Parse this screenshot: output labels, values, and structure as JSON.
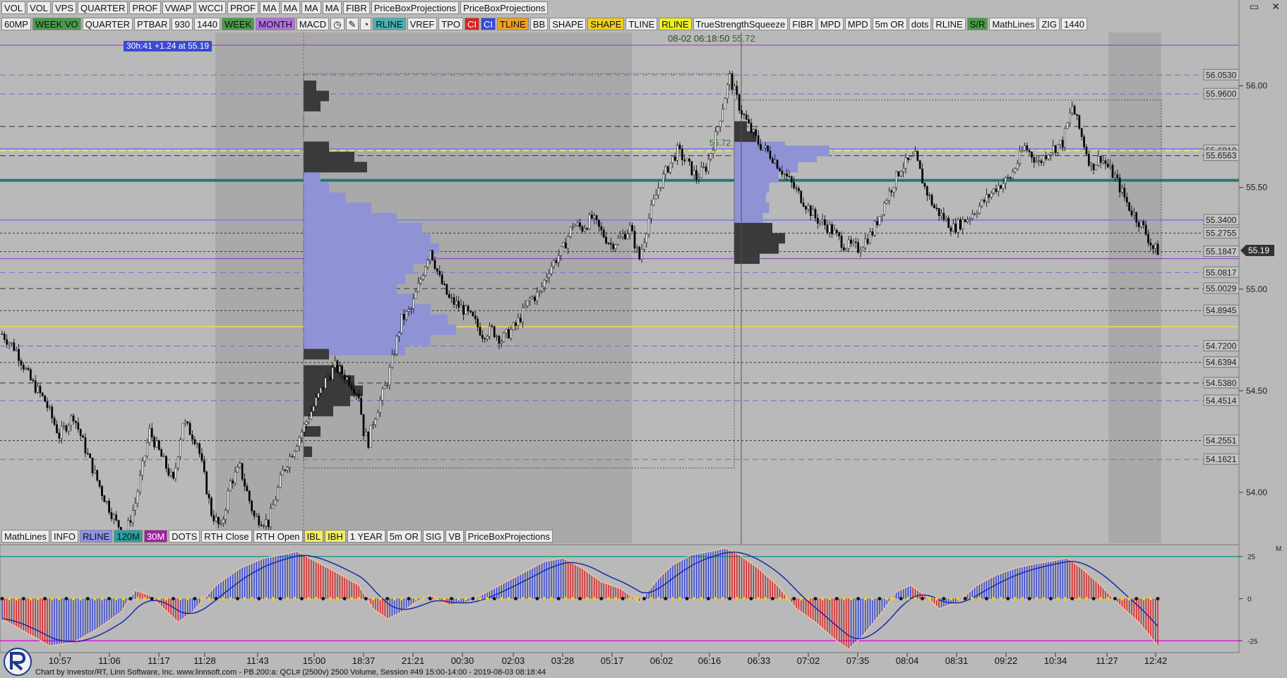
{
  "colors": {
    "background": "#b9b9b9",
    "rth_shade": "#a8a8a8",
    "profile_blue": "#8f93d6",
    "profile_black": "#3a3a3a",
    "candle_up": "#ffffff",
    "candle_down": "#000000",
    "dashed_blue": "#6a6fd6",
    "dashed_black": "#333333",
    "teal": "#1f7a72",
    "yellow": "#e8d066",
    "purple": "#8a38d8",
    "macd_red": "#e01010",
    "macd_blue": "#2a3ad8",
    "pink_line": "#e018e0",
    "teal_line": "#1aa090"
  },
  "toolbar_top": [
    {
      "label": "VOL",
      "bg": "#ececec"
    },
    {
      "label": "VOL",
      "bg": "#ececec"
    },
    {
      "label": "VPS",
      "bg": "#ececec"
    },
    {
      "label": "QUARTER",
      "bg": "#ececec"
    },
    {
      "label": "PROF",
      "bg": "#ececec"
    },
    {
      "label": "VWAP",
      "bg": "#ececec"
    },
    {
      "label": "WCCI",
      "bg": "#ececec"
    },
    {
      "label": "PROF",
      "bg": "#ececec"
    },
    {
      "label": "MA",
      "bg": "#ececec"
    },
    {
      "label": "MA",
      "bg": "#ececec"
    },
    {
      "label": "MA",
      "bg": "#ececec"
    },
    {
      "label": "MA",
      "bg": "#ececec"
    },
    {
      "label": "FIBR",
      "bg": "#ececec"
    },
    {
      "label": "PriceBoxProjections",
      "bg": "#ececec"
    },
    {
      "label": "PriceBoxProjections",
      "bg": "#ececec"
    }
  ],
  "toolbar_mid": [
    {
      "label": "60MP",
      "bg": "#ececec"
    },
    {
      "label": "WEEK VO",
      "bg": "#4a9a4a"
    },
    {
      "label": "QUARTER",
      "bg": "#ececec"
    },
    {
      "label": "PTBAR",
      "bg": "#ececec"
    },
    {
      "label": "930",
      "bg": "#ececec"
    },
    {
      "label": "1440",
      "bg": "#ececec"
    },
    {
      "label": "WEEK",
      "bg": "#4a9a4a"
    },
    {
      "label": "MONTH",
      "bg": "#b070e0"
    },
    {
      "label": "MACD",
      "bg": "#ececec"
    },
    {
      "label": "◷",
      "bg": "#ececec"
    },
    {
      "label": "✎",
      "bg": "#ececec"
    },
    {
      "label": "◔",
      "bg": "#ececec"
    },
    {
      "label": "RLINE",
      "bg": "#4ab0b0"
    },
    {
      "label": "VREF",
      "bg": "#ececec"
    },
    {
      "label": "TPO",
      "bg": "#ececec"
    },
    {
      "label": "CI",
      "bg": "#e02020"
    },
    {
      "label": "CI",
      "bg": "#3a4ad8"
    },
    {
      "label": "TLINE",
      "bg": "#f0a020"
    },
    {
      "label": "BB",
      "bg": "#ececec"
    },
    {
      "label": "SHAPE",
      "bg": "#ececec"
    },
    {
      "label": "SHAPE",
      "bg": "#f0d020"
    },
    {
      "label": "TLINE",
      "bg": "#ececec"
    },
    {
      "label": "RLINE",
      "bg": "#f0f020"
    },
    {
      "label": "TrueStrengthSqueeze",
      "bg": "#ececec"
    },
    {
      "label": "FIBR",
      "bg": "#ececec"
    },
    {
      "label": "MPD",
      "bg": "#ececec"
    },
    {
      "label": "MPD",
      "bg": "#ececec"
    },
    {
      "label": "5m OR",
      "bg": "#ececec"
    },
    {
      "label": "dots",
      "bg": "#ececec"
    },
    {
      "label": "RLINE",
      "bg": "#ececec"
    },
    {
      "label": "S/R",
      "bg": "#4a9a4a"
    },
    {
      "label": "MathLines",
      "bg": "#ececec"
    },
    {
      "label": "ZIG",
      "bg": "#ececec"
    },
    {
      "label": "1440",
      "bg": "#ececec"
    }
  ],
  "toolbar_bottom": [
    {
      "label": "MathLines",
      "bg": "#ececec"
    },
    {
      "label": "INFO",
      "bg": "#ececec"
    },
    {
      "label": "RLINE",
      "bg": "#8f93e6"
    },
    {
      "label": "120M",
      "bg": "#2aa0a0"
    },
    {
      "label": "30M",
      "bg": "#a020a0"
    },
    {
      "label": "DOTS",
      "bg": "#ececec"
    },
    {
      "label": "RTH Close",
      "bg": "#ececec"
    },
    {
      "label": "RTH Open",
      "bg": "#ececec"
    },
    {
      "label": "IBL",
      "bg": "#f0f060"
    },
    {
      "label": "IBH",
      "bg": "#f0f060"
    },
    {
      "label": "1 YEAR",
      "bg": "#ececec"
    },
    {
      "label": "5m OR",
      "bg": "#ececec"
    },
    {
      "label": "SIG",
      "bg": "#ececec"
    },
    {
      "label": "VB",
      "bg": "#ececec"
    },
    {
      "label": "PriceBoxProjections",
      "bg": "#ececec"
    }
  ],
  "window_controls": {
    "restore": "▭",
    "close": "✕"
  },
  "info_box": "30h:41  +1.24 at 55.19",
  "crosshair": {
    "time": "08-02 06:18:50",
    "value": "55.72"
  },
  "profile_label": "55.72",
  "footer": "Chart by Investor/RT, Linn Software, Inc. www.linnsoft.com - PB.200:a: QCL# (2500v) 2500 Volume, Session #49 15:00-14:00 - 2019-08-03 08:18:44",
  "macd_panel": {
    "ticks": [
      {
        "value": 25,
        "label": "25"
      },
      {
        "value": 0,
        "label": "0"
      },
      {
        "value": -25,
        "label": "-25"
      }
    ],
    "corner": "M"
  },
  "chart_data": {
    "type": "candlestick",
    "symbol": "QCL#",
    "ylim": [
      53.75,
      56.2
    ],
    "y_ticks": [
      {
        "value": 54.0,
        "label": "54.00"
      },
      {
        "value": 54.5,
        "label": "54.50"
      },
      {
        "value": 55.0,
        "label": "55.00"
      },
      {
        "value": 55.5,
        "label": "55.50"
      },
      {
        "value": 56.0,
        "label": "56.00"
      }
    ],
    "current_price": {
      "value": 55.19,
      "label": "55.19"
    },
    "x_labels": [
      "10:57",
      "11:06",
      "11:17",
      "11:28",
      "11:43",
      "15:00",
      "18:37",
      "21:21",
      "00:30",
      "02:03",
      "03:28",
      "05:17",
      "06:02",
      "06:16",
      "06:33",
      "07:02",
      "07:35",
      "08:04",
      "08:31",
      "09:22",
      "10:34",
      "11:27",
      "12:42"
    ],
    "price_levels": [
      {
        "value": 56.053,
        "label": "56.0530",
        "style": "blue-dash"
      },
      {
        "value": 55.96,
        "label": "55.9600",
        "style": "blue-dash"
      },
      {
        "value": 55.681,
        "label": "55.6810",
        "style": "yellow-dash"
      },
      {
        "value": 55.6563,
        "label": "55.6563",
        "style": "black-dash"
      },
      {
        "value": 55.34,
        "label": "55.3400",
        "style": "blue-solid"
      },
      {
        "value": 55.2755,
        "label": "55.2755",
        "style": "black-dot"
      },
      {
        "value": 55.1847,
        "label": "55.1847",
        "style": "black-dot"
      },
      {
        "value": 55.0817,
        "label": "55.0817",
        "style": "blue-dash"
      },
      {
        "value": 55.0029,
        "label": "55.0029",
        "style": "black-dash"
      },
      {
        "value": 54.8945,
        "label": "54.8945",
        "style": "black-dot"
      },
      {
        "value": 54.72,
        "label": "54.7200",
        "style": "blue-dash"
      },
      {
        "value": 54.6394,
        "label": "54.6394",
        "style": "black-dot"
      },
      {
        "value": 54.538,
        "label": "54.5380",
        "style": "black-dash"
      },
      {
        "value": 54.4514,
        "label": "54.4514",
        "style": "blue-dash"
      },
      {
        "value": 54.2551,
        "label": "54.2551",
        "style": "black-dot"
      },
      {
        "value": 54.1621,
        "label": "54.1621",
        "style": "blue-dash"
      }
    ],
    "extra_levels": [
      {
        "value": 56.2,
        "style": "purple"
      },
      {
        "value": 55.8,
        "style": "black-dash"
      },
      {
        "value": 55.535,
        "style": "teal"
      },
      {
        "value": 55.69,
        "style": "blue-solid"
      },
      {
        "value": 55.15,
        "style": "purple"
      },
      {
        "value": 54.815,
        "style": "yellow"
      }
    ],
    "close_path": [
      [
        0,
        54.78
      ],
      [
        6,
        54.7
      ],
      [
        12,
        54.55
      ],
      [
        18,
        54.45
      ],
      [
        24,
        54.28
      ],
      [
        30,
        54.38
      ],
      [
        36,
        54.18
      ],
      [
        42,
        54.0
      ],
      [
        48,
        53.85
      ],
      [
        52,
        53.8
      ],
      [
        56,
        53.95
      ],
      [
        62,
        54.3
      ],
      [
        68,
        54.15
      ],
      [
        72,
        54.05
      ],
      [
        76,
        54.35
      ],
      [
        82,
        54.25
      ],
      [
        88,
        53.9
      ],
      [
        92,
        53.82
      ],
      [
        96,
        54.05
      ],
      [
        100,
        54.12
      ],
      [
        106,
        53.88
      ],
      [
        112,
        53.85
      ],
      [
        118,
        54.1
      ],
      [
        124,
        54.25
      ],
      [
        130,
        54.4
      ],
      [
        136,
        54.55
      ],
      [
        140,
        54.62
      ],
      [
        146,
        54.55
      ],
      [
        150,
        54.48
      ],
      [
        152,
        54.3
      ],
      [
        154,
        54.25
      ],
      [
        156,
        54.35
      ],
      [
        162,
        54.55
      ],
      [
        168,
        54.85
      ],
      [
        172,
        54.9
      ],
      [
        176,
        55.05
      ],
      [
        180,
        55.2
      ],
      [
        184,
        55.05
      ],
      [
        188,
        54.95
      ],
      [
        194,
        54.9
      ],
      [
        198,
        54.85
      ],
      [
        202,
        54.78
      ],
      [
        206,
        54.8
      ],
      [
        210,
        54.75
      ],
      [
        216,
        54.82
      ],
      [
        222,
        54.95
      ],
      [
        226,
        54.98
      ],
      [
        230,
        55.1
      ],
      [
        236,
        55.2
      ],
      [
        240,
        55.32
      ],
      [
        244,
        55.3
      ],
      [
        248,
        55.35
      ],
      [
        252,
        55.28
      ],
      [
        256,
        55.22
      ],
      [
        260,
        55.25
      ],
      [
        264,
        55.3
      ],
      [
        268,
        55.15
      ],
      [
        272,
        55.35
      ],
      [
        276,
        55.5
      ],
      [
        280,
        55.6
      ],
      [
        284,
        55.68
      ],
      [
        288,
        55.62
      ],
      [
        292,
        55.55
      ],
      [
        296,
        55.6
      ],
      [
        300,
        55.75
      ],
      [
        304,
        55.95
      ],
      [
        306,
        56.04
      ],
      [
        310,
        55.9
      ],
      [
        314,
        55.8
      ],
      [
        318,
        55.72
      ],
      [
        324,
        55.65
      ],
      [
        330,
        55.55
      ],
      [
        336,
        55.45
      ],
      [
        342,
        55.35
      ],
      [
        348,
        55.3
      ],
      [
        354,
        55.22
      ],
      [
        360,
        55.2
      ],
      [
        366,
        55.28
      ],
      [
        372,
        55.45
      ],
      [
        378,
        55.6
      ],
      [
        384,
        55.65
      ],
      [
        388,
        55.5
      ],
      [
        392,
        55.4
      ],
      [
        396,
        55.35
      ],
      [
        400,
        55.3
      ],
      [
        406,
        55.35
      ],
      [
        412,
        55.42
      ],
      [
        418,
        55.5
      ],
      [
        424,
        55.55
      ],
      [
        430,
        55.7
      ],
      [
        436,
        55.62
      ],
      [
        440,
        55.68
      ],
      [
        446,
        55.72
      ],
      [
        450,
        55.9
      ],
      [
        454,
        55.75
      ],
      [
        458,
        55.6
      ],
      [
        462,
        55.65
      ],
      [
        468,
        55.55
      ],
      [
        474,
        55.4
      ],
      [
        480,
        55.3
      ],
      [
        484,
        55.2
      ],
      [
        486,
        55.19
      ]
    ],
    "profiles": [
      {
        "name": "overnight",
        "blue_rows": [
          [
            55.55,
            40
          ],
          [
            55.5,
            60
          ],
          [
            55.45,
            100
          ],
          [
            55.4,
            160
          ],
          [
            55.35,
            220
          ],
          [
            55.3,
            280
          ],
          [
            55.25,
            300
          ],
          [
            55.2,
            320
          ],
          [
            55.15,
            300
          ],
          [
            55.1,
            260
          ],
          [
            55.05,
            240
          ],
          [
            55.0,
            220
          ],
          [
            54.95,
            260
          ],
          [
            54.9,
            300
          ],
          [
            54.85,
            340
          ],
          [
            54.8,
            360
          ],
          [
            54.75,
            300
          ],
          [
            54.7,
            240
          ]
        ],
        "black_rows": [
          [
            55.7,
            60
          ],
          [
            55.65,
            120
          ],
          [
            55.6,
            150
          ],
          [
            54.68,
            60
          ],
          [
            54.6,
            90
          ],
          [
            54.55,
            120
          ],
          [
            54.5,
            140
          ],
          [
            54.45,
            110
          ],
          [
            54.4,
            70
          ],
          [
            54.3,
            40
          ],
          [
            54.2,
            20
          ],
          [
            55.9,
            40
          ],
          [
            55.95,
            60
          ],
          [
            56.0,
            30
          ]
        ]
      },
      {
        "name": "rth",
        "blue_rows": [
          [
            55.75,
            60
          ],
          [
            55.7,
            160
          ],
          [
            55.68,
            300
          ],
          [
            55.65,
            260
          ],
          [
            55.6,
            200
          ],
          [
            55.55,
            140
          ],
          [
            55.5,
            110
          ],
          [
            55.45,
            100
          ],
          [
            55.4,
            110
          ],
          [
            55.35,
            90
          ],
          [
            55.3,
            60
          ]
        ],
        "black_rows": [
          [
            55.8,
            40
          ],
          [
            55.75,
            70
          ],
          [
            55.3,
            120
          ],
          [
            55.25,
            160
          ],
          [
            55.2,
            140
          ],
          [
            55.15,
            80
          ]
        ]
      }
    ],
    "macd": {
      "ylim": [
        -32,
        32
      ],
      "hist": [
        [
          0,
          -12
        ],
        [
          10,
          -20
        ],
        [
          20,
          -28
        ],
        [
          30,
          -26
        ],
        [
          40,
          -18
        ],
        [
          50,
          -8
        ],
        [
          56,
          5
        ],
        [
          62,
          2
        ],
        [
          68,
          -6
        ],
        [
          74,
          -14
        ],
        [
          80,
          -8
        ],
        [
          90,
          8
        ],
        [
          100,
          18
        ],
        [
          110,
          24
        ],
        [
          118,
          26
        ],
        [
          124,
          28
        ],
        [
          132,
          22
        ],
        [
          140,
          16
        ],
        [
          150,
          8
        ],
        [
          156,
          -6
        ],
        [
          162,
          -12
        ],
        [
          168,
          -8
        ],
        [
          174,
          -2
        ],
        [
          180,
          2
        ],
        [
          188,
          -4
        ],
        [
          196,
          -2
        ],
        [
          204,
          4
        ],
        [
          212,
          10
        ],
        [
          220,
          16
        ],
        [
          228,
          22
        ],
        [
          236,
          24
        ],
        [
          244,
          18
        ],
        [
          252,
          10
        ],
        [
          260,
          6
        ],
        [
          268,
          -2
        ],
        [
          276,
          12
        ],
        [
          282,
          20
        ],
        [
          290,
          26
        ],
        [
          298,
          28
        ],
        [
          304,
          30
        ],
        [
          310,
          26
        ],
        [
          318,
          18
        ],
        [
          326,
          8
        ],
        [
          334,
          -6
        ],
        [
          342,
          -14
        ],
        [
          350,
          -24
        ],
        [
          356,
          -30
        ],
        [
          362,
          -22
        ],
        [
          370,
          -8
        ],
        [
          376,
          4
        ],
        [
          382,
          8
        ],
        [
          388,
          2
        ],
        [
          394,
          -6
        ],
        [
          402,
          -2
        ],
        [
          410,
          8
        ],
        [
          418,
          14
        ],
        [
          426,
          18
        ],
        [
          432,
          20
        ],
        [
          440,
          22
        ],
        [
          448,
          24
        ],
        [
          454,
          18
        ],
        [
          462,
          8
        ],
        [
          470,
          -4
        ],
        [
          478,
          -14
        ],
        [
          486,
          -28
        ]
      ]
    }
  }
}
